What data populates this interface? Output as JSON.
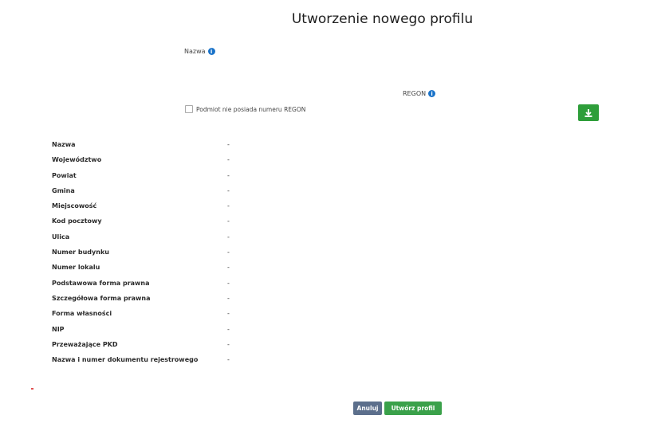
{
  "page": {
    "title": "Utworzenie nowego profilu"
  },
  "form": {
    "name_label": "Nazwa",
    "name_value": "",
    "regon_label": "REGON",
    "no_regon_checkbox_label": "Podmiot nie posiada numeru REGON",
    "no_regon_checked": false
  },
  "details": [
    {
      "label": "Nazwa",
      "value": "-"
    },
    {
      "label": "Województwo",
      "value": "-"
    },
    {
      "label": "Powiat",
      "value": "-"
    },
    {
      "label": "Gmina",
      "value": "-"
    },
    {
      "label": "Miejscowość",
      "value": "-"
    },
    {
      "label": "Kod pocztowy",
      "value": "-"
    },
    {
      "label": "Ulica",
      "value": "-"
    },
    {
      "label": "Numer budynku",
      "value": "-"
    },
    {
      "label": "Numer lokalu",
      "value": "-"
    },
    {
      "label": "Podstawowa forma prawna",
      "value": "-"
    },
    {
      "label": "Szczegółowa forma prawna",
      "value": "-"
    },
    {
      "label": "Forma własności",
      "value": "-"
    },
    {
      "label": "NIP",
      "value": "-"
    },
    {
      "label": "Przeważające PKD",
      "value": "-"
    },
    {
      "label": "Nazwa i numer dokumentu rejestrowego",
      "value": "-"
    }
  ],
  "actions": {
    "cancel_label": "Anuluj",
    "create_label": "Utwórz profil"
  },
  "icons": {
    "info": "info-icon",
    "download": "download-icon"
  },
  "colors": {
    "primary_green": "#2e9e3a",
    "cancel_blue_gray": "#5c6f8c",
    "info_blue": "#1a73c9"
  }
}
